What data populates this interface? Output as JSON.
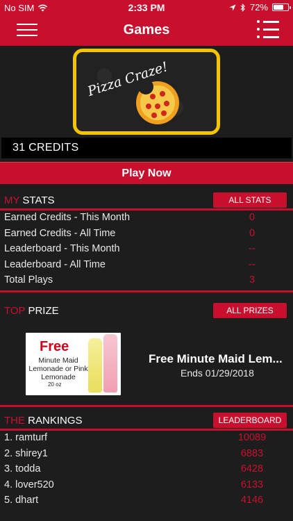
{
  "status_bar": {
    "carrier": "No SIM",
    "time": "2:33 PM",
    "battery": "72%",
    "battery_level": 0.72,
    "icons": [
      "wifi-icon",
      "location-arrow-icon",
      "bluetooth-icon",
      "battery-icon"
    ]
  },
  "nav": {
    "title": "Games",
    "left_icon": "hamburger-menu-icon",
    "right_icon": "list-icon"
  },
  "game": {
    "name": "Pizza Craze!",
    "credits": "31 CREDITS",
    "play_label": "Play Now"
  },
  "stats": {
    "heading_accent": "MY",
    "heading_rest": " STATS",
    "button_label": "ALL STATS",
    "rows": [
      {
        "label": "Earned Credits - This Month",
        "value": "0"
      },
      {
        "label": "Earned Credits - All Time",
        "value": "0"
      },
      {
        "label": "Leaderboard - This Month",
        "value": "--"
      },
      {
        "label": "Leaderboard - All Time",
        "value": "--"
      },
      {
        "label": "Total Plays",
        "value": "3"
      }
    ]
  },
  "prize": {
    "heading_accent": "TOP",
    "heading_rest": " PRIZE",
    "button_label": "ALL PRIZES",
    "image_free": "Free",
    "image_desc": "Minute Maid Lemonade or Pink Lemonade",
    "image_size": "20 oz",
    "title": "Free Minute Maid Lem...",
    "ends": "Ends 01/29/2018"
  },
  "rankings": {
    "heading_accent": "THE",
    "heading_rest": " RANKINGS",
    "button_label": "LEADERBOARD",
    "rows": [
      {
        "label": "1. ramturf",
        "value": "10089"
      },
      {
        "label": "2. shirey1",
        "value": "6883"
      },
      {
        "label": "3. todda",
        "value": "6428"
      },
      {
        "label": "4. lover520",
        "value": "6133"
      },
      {
        "label": "5. dhart",
        "value": "4146"
      }
    ]
  },
  "colors": {
    "accent": "#c8102e",
    "background": "#1d1d1d",
    "gold": "#f5c400"
  }
}
